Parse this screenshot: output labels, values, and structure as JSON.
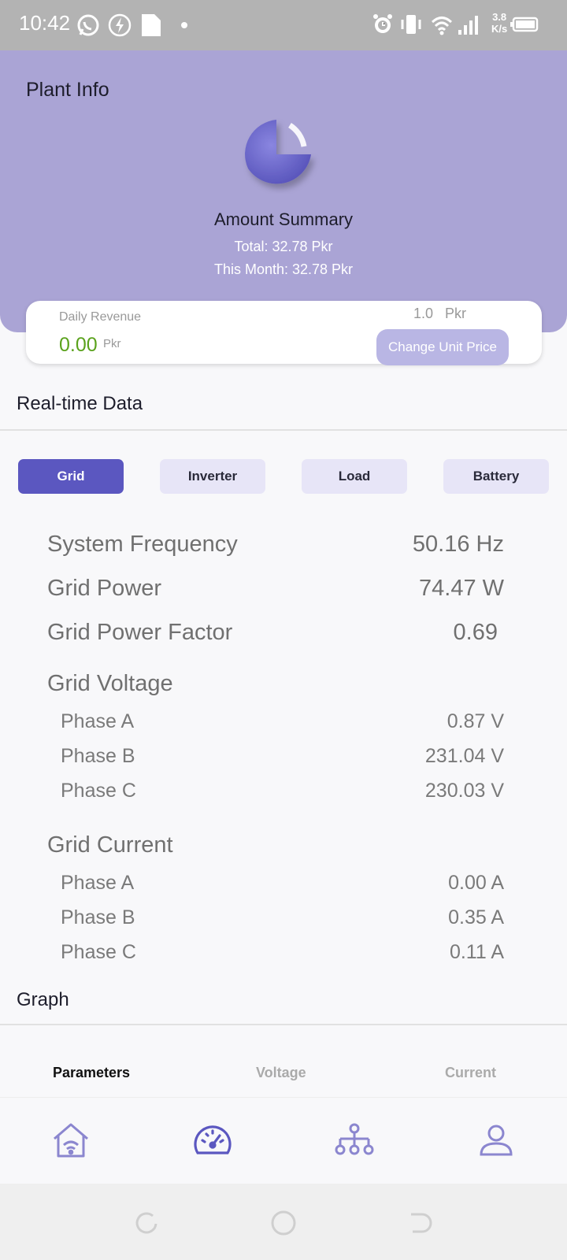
{
  "status_bar": {
    "time": "10:42",
    "net_speed_value": "3.8",
    "net_speed_unit": "K/s",
    "icons": [
      "whatsapp-icon",
      "charging-icon",
      "sd-card-icon",
      "alarm-icon",
      "vibrate-icon",
      "wifi-icon",
      "signal-icon",
      "battery-icon"
    ]
  },
  "header": {
    "title": "Plant Info",
    "summary_title": "Amount Summary",
    "total": "Total: 32.78 Pkr",
    "this_month": "This Month: 32.78 Pkr",
    "colors": {
      "background": "#aaa4d5",
      "pie": "#5b57c0"
    }
  },
  "revenue_card": {
    "label": "Daily Revenue",
    "value": "0.00",
    "unit": "Pkr",
    "unit_price": "1.0",
    "unit_price_currency": "Pkr",
    "change_button": "Change Unit Price"
  },
  "realtime": {
    "title": "Real-time Data",
    "tabs": [
      {
        "label": "Grid",
        "active": true
      },
      {
        "label": "Inverter",
        "active": false
      },
      {
        "label": "Load",
        "active": false
      },
      {
        "label": "Battery",
        "active": false
      }
    ],
    "system_frequency": {
      "label": "System Frequency",
      "value": "50.16 Hz"
    },
    "grid_power": {
      "label": "Grid Power",
      "value": "74.47 W"
    },
    "grid_power_factor": {
      "label": "Grid Power Factor",
      "value": "0.69"
    },
    "grid_voltage": {
      "label": "Grid Voltage",
      "phases": [
        {
          "label": "Phase A",
          "value": "0.87 V"
        },
        {
          "label": "Phase B",
          "value": "231.04 V"
        },
        {
          "label": "Phase C",
          "value": "230.03 V"
        }
      ]
    },
    "grid_current": {
      "label": "Grid Current",
      "phases": [
        {
          "label": "Phase A",
          "value": "0.00 A"
        },
        {
          "label": "Phase B",
          "value": "0.35 A"
        },
        {
          "label": "Phase C",
          "value": "0.11 A"
        }
      ]
    }
  },
  "graph": {
    "title": "Graph",
    "tabs": [
      {
        "label": "Parameters",
        "active": true
      },
      {
        "label": "Voltage",
        "active": false
      },
      {
        "label": "Current",
        "active": false
      }
    ]
  },
  "bottom_nav": {
    "items": [
      "home-wifi-icon",
      "dashboard-gauge-icon",
      "network-tree-icon",
      "profile-icon"
    ],
    "active_index": 1,
    "accent_color": "#8b86cf"
  },
  "system_nav": [
    "recent-apps-icon",
    "home-circle-icon",
    "back-icon"
  ]
}
